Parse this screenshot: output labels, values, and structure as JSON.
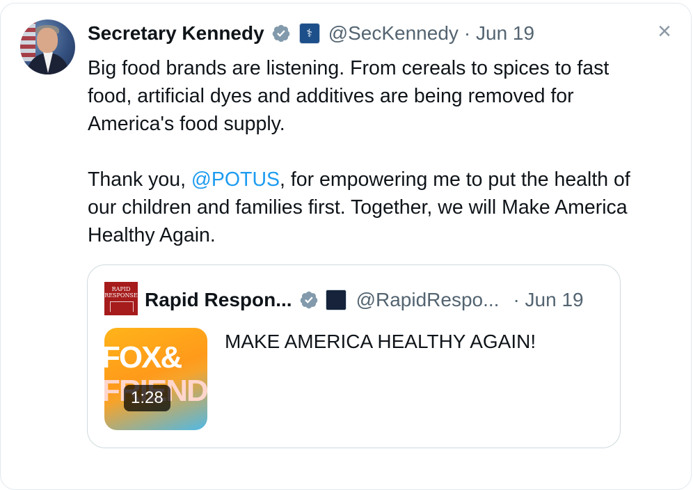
{
  "tweet": {
    "author_name": "Secretary Kennedy",
    "handle": "@SecKennedy",
    "date": "· Jun 19",
    "text_p1": "Big food brands are listening. From cereals to spices to fast food, artificial dyes and additives are being removed for America's food supply.",
    "text_p2_before": "Thank you, ",
    "text_p2_mention": "@POTUS",
    "text_p2_after": ", for empowering me to put the health of our children and families first. Together, we will Make America Healthy Again.",
    "close_icon": "close-icon",
    "verified_icon": "verified-badge-icon",
    "org_icon": "hhs-affiliate-icon"
  },
  "quote": {
    "avatar_text": "RAPID RESPONSE",
    "author_name": "Rapid Respon...",
    "handle": "@RapidRespo...",
    "date": "· Jun 19",
    "text": "MAKE AMERICA HEALTHY AGAIN!",
    "video": {
      "duration": "1:28",
      "thumbnail_text_line1": "FOX&",
      "thumbnail_text_line2": "FRIENDS"
    }
  },
  "colors": {
    "text_primary": "#0f1419",
    "text_secondary": "#536471",
    "link": "#1d9bf0",
    "verified": "#829aab",
    "border": "#cfd9de"
  }
}
